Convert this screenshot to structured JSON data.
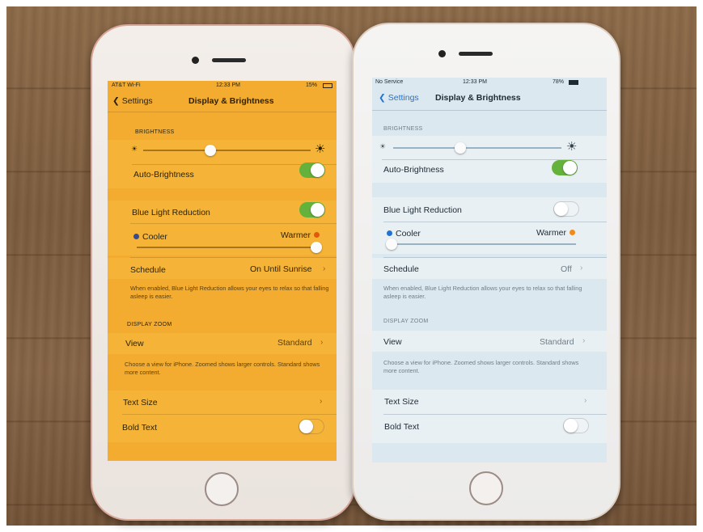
{
  "left_phone": {
    "status": {
      "carrier": "AT&T Wi-Fi",
      "time": "12:33 PM",
      "battery": "15%"
    },
    "nav": {
      "back_label": "Settings",
      "title": "Display & Brightness"
    },
    "brightness_header": "BRIGHTNESS",
    "brightness_level": 0.4,
    "auto_brightness": {
      "label": "Auto-Brightness",
      "on": true
    },
    "blue_light": {
      "label": "Blue Light Reduction",
      "on": true
    },
    "temperature": {
      "cooler_label": "Cooler",
      "warmer_label": "Warmer",
      "level": 1.0
    },
    "schedule": {
      "label": "Schedule",
      "value": "On Until Sunrise"
    },
    "schedule_note": "When enabled, Blue Light Reduction allows your eyes to relax so that falling asleep is easier.",
    "zoom_header": "DISPLAY ZOOM",
    "view": {
      "label": "View",
      "value": "Standard"
    },
    "view_note": "Choose a view for iPhone. Zoomed shows larger controls. Standard shows more content.",
    "text_size_label": "Text Size",
    "bold_text": {
      "label": "Bold Text",
      "on": false
    }
  },
  "right_phone": {
    "status": {
      "carrier": "No Service",
      "time": "12:33 PM",
      "battery": "78%"
    },
    "nav": {
      "back_label": "Settings",
      "title": "Display & Brightness"
    },
    "brightness_header": "BRIGHTNESS",
    "brightness_level": 0.4,
    "auto_brightness": {
      "label": "Auto-Brightness",
      "on": true
    },
    "blue_light": {
      "label": "Blue Light Reduction",
      "on": false
    },
    "temperature": {
      "cooler_label": "Cooler",
      "warmer_label": "Warmer",
      "level": 0.0
    },
    "schedule": {
      "label": "Schedule",
      "value": "Off"
    },
    "schedule_note": "When enabled, Blue Light Reduction allows your eyes to relax so that falling asleep is easier.",
    "zoom_header": "DISPLAY ZOOM",
    "view": {
      "label": "View",
      "value": "Standard"
    },
    "view_note": "Choose a view for iPhone. Zoomed shows larger controls. Standard shows more content.",
    "text_size_label": "Text Size",
    "bold_text": {
      "label": "Bold Text",
      "on": false
    }
  },
  "colors": {
    "toggle_on": "#64b13b",
    "cooler_dot": "#1f73d6",
    "warmer_dot": "#f08a1c",
    "left_tint": "#f3ac2f",
    "right_tint": "#dce8ef"
  },
  "icons": [
    "back-chevron-icon",
    "sun-small-icon",
    "sun-large-icon",
    "disclosure-chevron-icon",
    "wifi-icon",
    "battery-icon"
  ]
}
